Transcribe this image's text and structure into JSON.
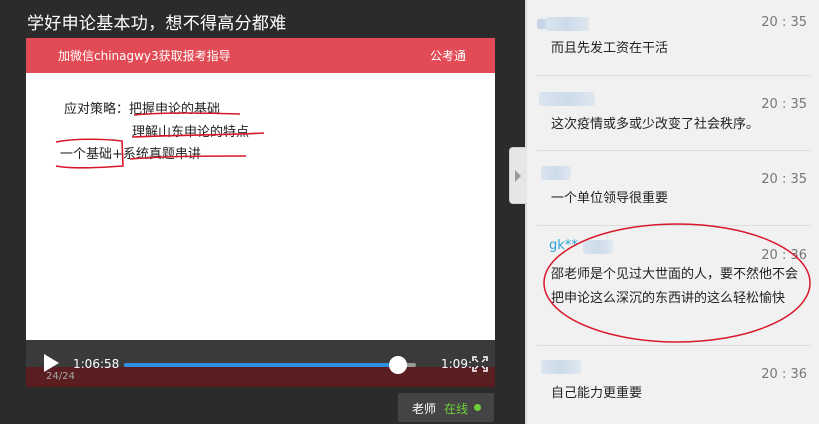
{
  "page_title": "学好申论基本功，想不得高分都难",
  "slide": {
    "banner_left": "加微信chinagwy3获取报考指导",
    "banner_right": "公考通",
    "line1": "应对策略：把握申论的基础",
    "line2": "理解山东申论的特点",
    "line3": "一个基础+系统真题串讲"
  },
  "player": {
    "current_time": "1:06:58",
    "total_time": "1:09:",
    "progress_fraction": 0.94,
    "page_indicator": "24/24"
  },
  "teacher": {
    "label": "老师",
    "status": "在线"
  },
  "chat": {
    "messages": [
      {
        "name": "",
        "time": "20 : 35",
        "text": "而且先发工资在干活"
      },
      {
        "name": "",
        "time": "20 : 35",
        "text": "这次疫情或多或少改变了社会秩序。"
      },
      {
        "name": "",
        "time": "20 : 35",
        "text": "一个单位领导很重要"
      },
      {
        "name": "gk**",
        "time": "20 : 36",
        "text": "邵老师是个见过大世面的人，要不然他不会把申论这么深沉的东西讲的这么轻松愉快"
      },
      {
        "name": "",
        "time": "20 : 36",
        "text": "自己能力更重要"
      }
    ]
  },
  "colors": {
    "banner": "#e24b55",
    "progress": "#2e8fe0",
    "online": "#6fcf3a",
    "annotation": "#d8182a"
  }
}
